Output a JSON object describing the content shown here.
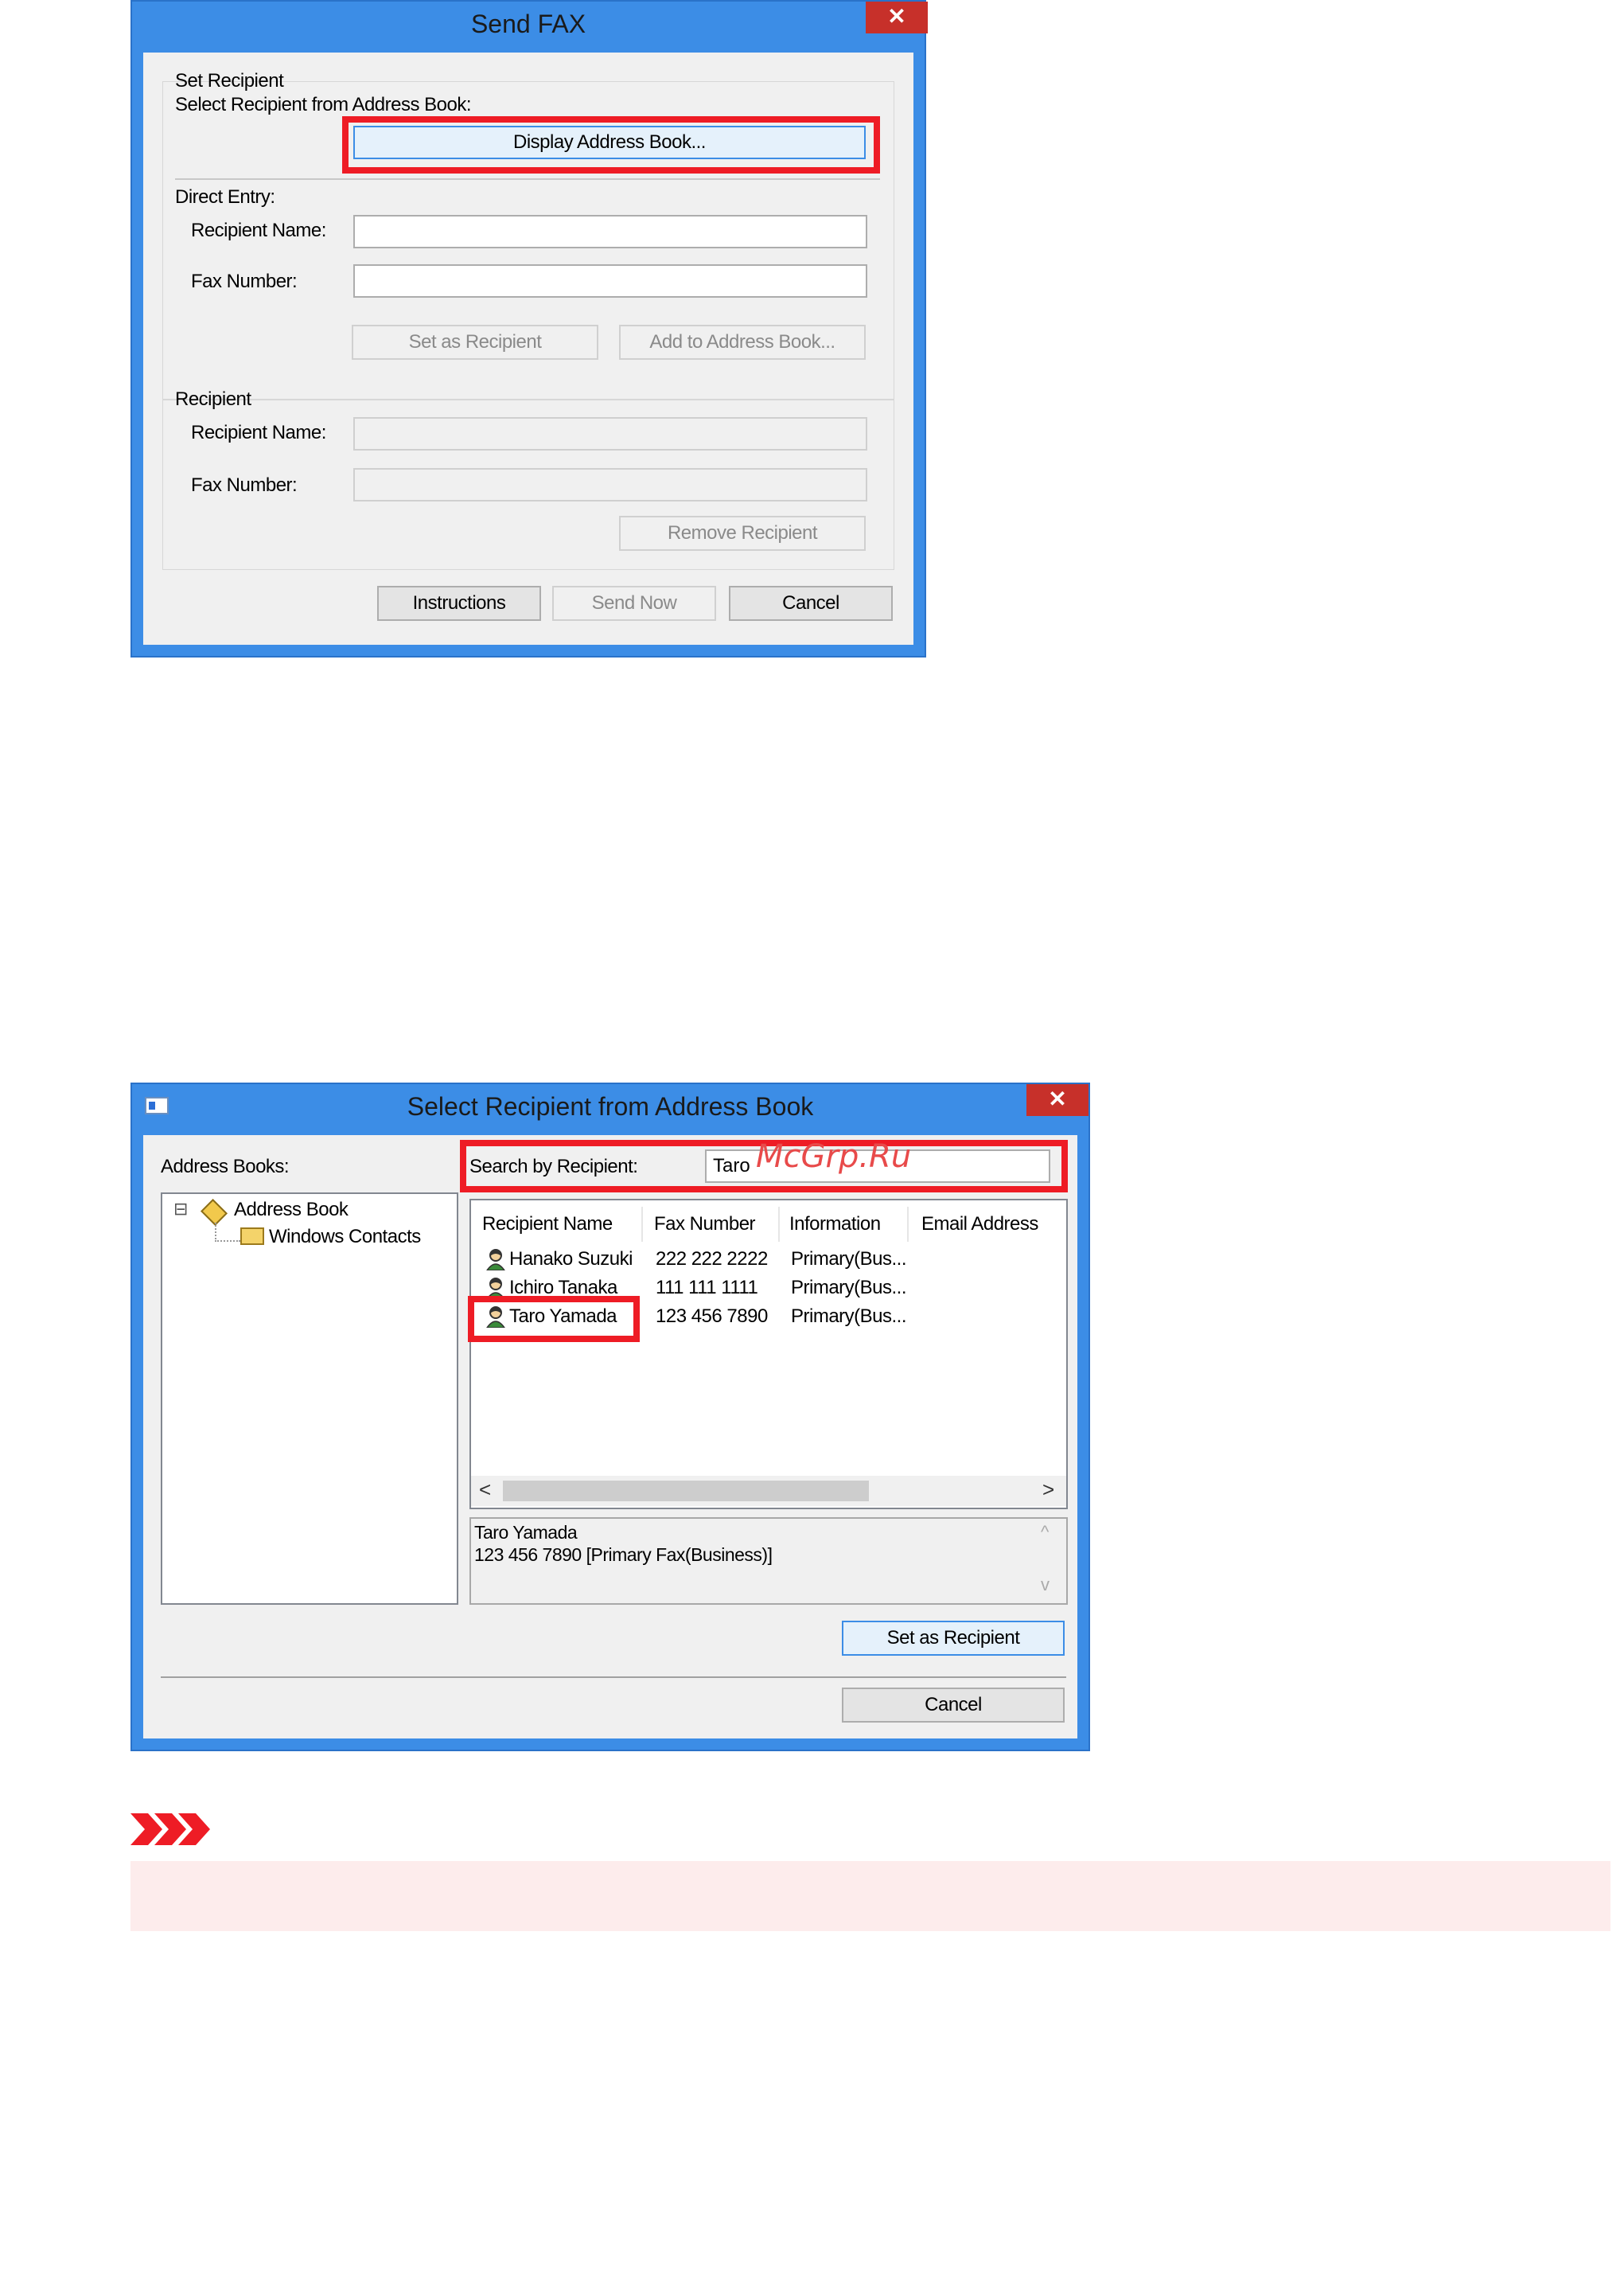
{
  "send_fax": {
    "title": "Send FAX",
    "close": "✕",
    "set_recipient_group": "Set Recipient",
    "select_from_book_label": "Select Recipient from Address Book:",
    "display_address_book_button": "Display Address Book...",
    "direct_entry_label": "Direct Entry:",
    "recipient_name_label": "Recipient Name:",
    "fax_number_label": "Fax Number:",
    "recipient_name_value": "",
    "fax_number_value": "",
    "set_as_recipient_button": "Set as Recipient",
    "add_to_address_book_button": "Add to Address Book...",
    "recipient_group": "Recipient",
    "recipient_name_label2": "Recipient Name:",
    "fax_number_label2": "Fax Number:",
    "remove_recipient_button": "Remove Recipient",
    "instructions_button": "Instructions",
    "send_now_button": "Send Now",
    "cancel_button": "Cancel"
  },
  "select_recipient": {
    "title": "Select Recipient from Address Book",
    "close": "✕",
    "address_books_label": "Address Books:",
    "tree": {
      "expander": "⊟",
      "root": "Address Book",
      "child": "Windows Contacts"
    },
    "search_label": "Search by Recipient:",
    "search_value": "Taro",
    "columns": [
      "Recipient Name",
      "Fax Number",
      "Information",
      "Email Address"
    ],
    "rows": [
      {
        "name": "Hanako Suzuki",
        "fax": "222 222 2222",
        "info": "Primary(Bus...",
        "email": ""
      },
      {
        "name": "Ichiro Tanaka",
        "fax": "111 111 1111",
        "info": "Primary(Bus...",
        "email": ""
      },
      {
        "name": "Taro Yamada",
        "fax": "123 456 7890",
        "info": "Primary(Bus...",
        "email": ""
      }
    ],
    "scroll_left": "<",
    "scroll_right": ">",
    "detail_line1": "Taro Yamada",
    "detail_line2": "123 456 7890 [Primary Fax(Business)]",
    "detail_scroll_up": "^",
    "detail_scroll_down": "v",
    "set_as_recipient_button": "Set as Recipient",
    "cancel_button": "Cancel"
  },
  "watermark": "McGrp.Ru",
  "colors": {
    "window_border": "#3c8de6",
    "close_button": "#c7302a",
    "highlight_box": "#ee1c25",
    "important_bar": "#fdecec"
  }
}
